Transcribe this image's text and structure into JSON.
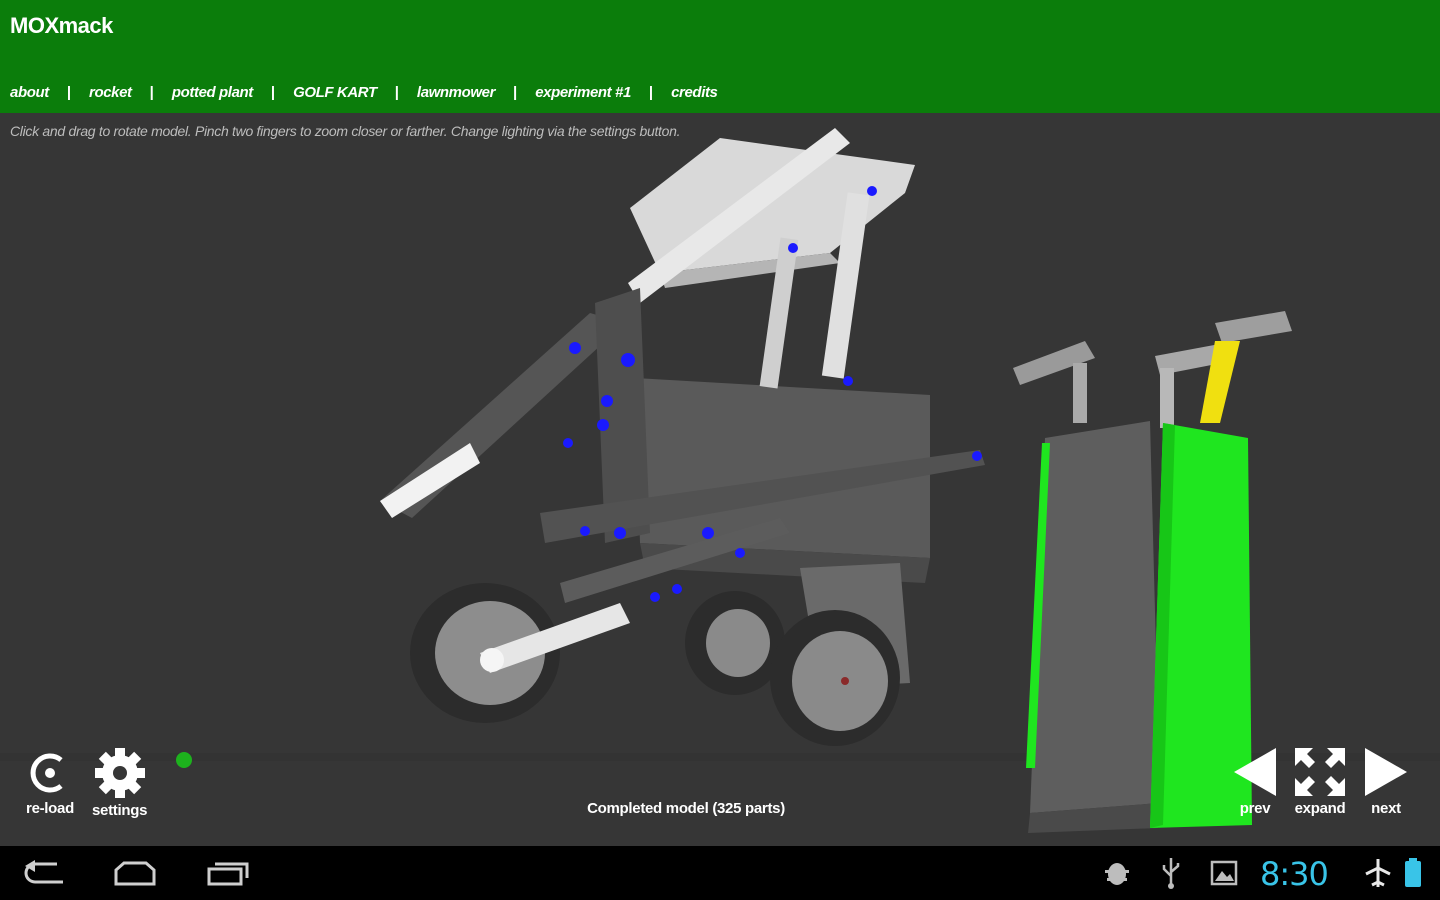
{
  "app": {
    "title": "MOXmack"
  },
  "nav": {
    "items": [
      {
        "label": "about"
      },
      {
        "label": "rocket"
      },
      {
        "label": "potted plant"
      },
      {
        "label": "GOLF KART"
      },
      {
        "label": "lawnmower"
      },
      {
        "label": "experiment #1"
      },
      {
        "label": "credits"
      }
    ],
    "separator": "|"
  },
  "hint": "Click and drag to rotate model. Pinch two fingers to zoom closer or farther. Change lighting via the settings button.",
  "controls": {
    "reload_label": "re-load",
    "settings_label": "settings",
    "prev_label": "prev",
    "expand_label": "expand",
    "next_label": "next"
  },
  "status": "Completed model (325 parts)",
  "system": {
    "time": "8:30",
    "clock_color": "#39c4e8",
    "icons": [
      "back-icon",
      "home-icon",
      "recent-apps-icon",
      "android-debug-icon",
      "usb-icon",
      "gallery-icon",
      "airplane-mode-icon",
      "battery-icon"
    ]
  },
  "colors": {
    "header": "#0b7d0b",
    "viewport": "#363636",
    "bag_green": "#1fe61f",
    "accent_blue": "#1a1aff"
  }
}
